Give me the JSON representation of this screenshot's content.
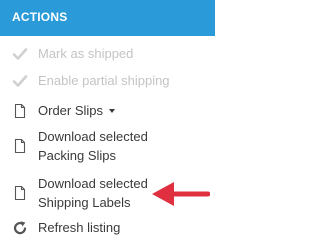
{
  "header": {
    "title": "ACTIONS"
  },
  "items": [
    {
      "label": "Mark as shipped",
      "icon": "check-icon",
      "disabled": true
    },
    {
      "label": "Enable partial shipping",
      "icon": "check-icon",
      "disabled": true
    },
    {
      "label": "Order Slips",
      "icon": "document-icon",
      "has_dropdown": true
    },
    {
      "label_line1": "Download selected",
      "label_line2": "Packing Slips",
      "icon": "document-icon"
    },
    {
      "label_line1": "Download selected",
      "label_line2": "Shipping Labels",
      "icon": "document-icon"
    },
    {
      "label": "Refresh listing",
      "icon": "refresh-icon"
    }
  ],
  "colors": {
    "header_bg": "#2a9ad8",
    "disabled_text": "#c4c4c4",
    "text": "#3a3a3a",
    "arrow": "#e03040"
  }
}
